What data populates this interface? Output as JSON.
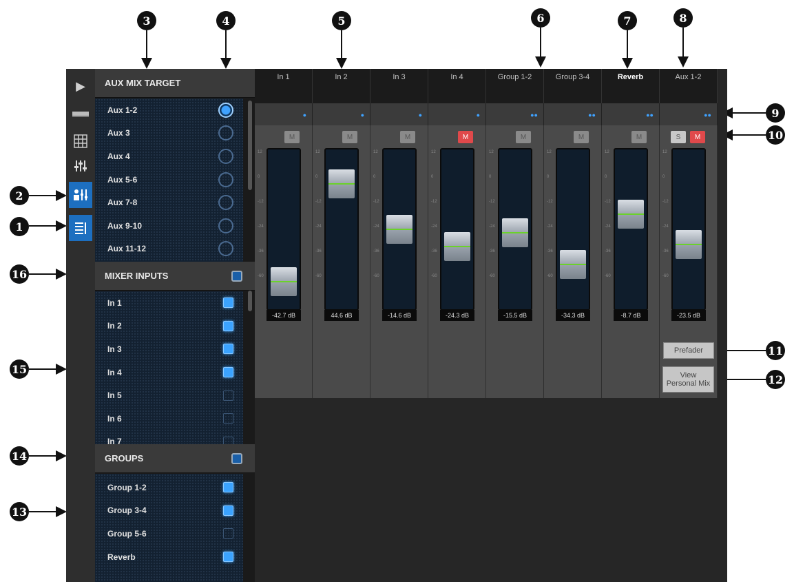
{
  "callouts": [
    "1",
    "2",
    "3",
    "4",
    "5",
    "6",
    "7",
    "8",
    "9",
    "10",
    "11",
    "12",
    "13",
    "14",
    "15",
    "16"
  ],
  "icons": {
    "expand": "play-triangle-icon",
    "device": "device-icon",
    "grid": "grid-icon",
    "faders": "faders-icon",
    "aux_mix": "aux-mix-icon",
    "list": "list-icon"
  },
  "aux_mix_target": {
    "title": "AUX MIX TARGET",
    "items": [
      {
        "label": "Aux 1-2",
        "selected": true
      },
      {
        "label": "Aux 3",
        "selected": false
      },
      {
        "label": "Aux 4",
        "selected": false
      },
      {
        "label": "Aux 5-6",
        "selected": false
      },
      {
        "label": "Aux 7-8",
        "selected": false
      },
      {
        "label": "Aux 9-10",
        "selected": false
      },
      {
        "label": "Aux 11-12",
        "selected": false
      }
    ]
  },
  "mixer_inputs": {
    "title": "MIXER INPUTS",
    "items": [
      {
        "label": "In 1",
        "checked": true
      },
      {
        "label": "In 2",
        "checked": true
      },
      {
        "label": "In 3",
        "checked": true
      },
      {
        "label": "In 4",
        "checked": true
      },
      {
        "label": "In 5",
        "checked": false
      },
      {
        "label": "In 6",
        "checked": false
      },
      {
        "label": "In 7",
        "checked": false
      }
    ]
  },
  "groups": {
    "title": "GROUPS",
    "items": [
      {
        "label": "Group 1-2",
        "checked": true
      },
      {
        "label": "Group 3-4",
        "checked": true
      },
      {
        "label": "Group 5-6",
        "checked": false
      },
      {
        "label": "Reverb",
        "checked": true
      }
    ]
  },
  "channels": [
    {
      "name": "In 1",
      "db": "-42.7 dB",
      "level": 0.08,
      "mute_label": "M",
      "muted": false
    },
    {
      "name": "In 2",
      "db": "44.6 dB",
      "level": 0.86,
      "mute_label": "M",
      "muted": false
    },
    {
      "name": "In 3",
      "db": "-14.6 dB",
      "level": 0.5,
      "mute_label": "M",
      "muted": false
    },
    {
      "name": "In 4",
      "db": "-24.3 dB",
      "level": 0.36,
      "mute_label": "M",
      "muted": true
    },
    {
      "name": "Group 1-2",
      "db": "-15.5 dB",
      "level": 0.47,
      "mute_label": "M",
      "muted": false
    },
    {
      "name": "Group 3-4",
      "db": "-34.3 dB",
      "level": 0.22,
      "mute_label": "M",
      "muted": false
    },
    {
      "name": "Reverb",
      "db": "-8.7 dB",
      "level": 0.62,
      "mute_label": "M",
      "muted": false,
      "bold": true
    },
    {
      "name": "Aux 1-2",
      "db": "-23.5 dB",
      "level": 0.38,
      "mute_label": "M",
      "muted": true,
      "solo_label": "S"
    }
  ],
  "scale_ticks": [
    "12",
    "0",
    "-12",
    "-24",
    "-36",
    "-60"
  ],
  "buttons": {
    "prefader": "Prefader",
    "view_personal_mix": "View Personal Mix"
  },
  "colors": {
    "accent": "#3ba3ff",
    "mute_active": "#e0494b",
    "fader_line": "#6bd22a"
  }
}
